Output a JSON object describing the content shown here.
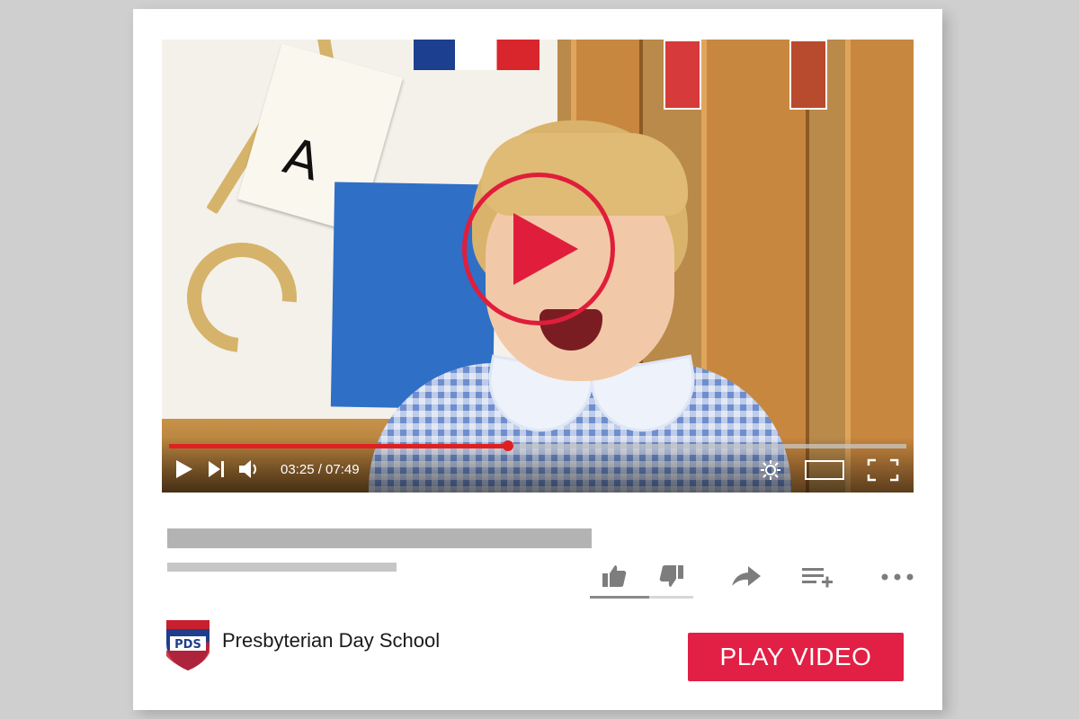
{
  "player": {
    "time_display": "03:25 / 07:49",
    "progress_fraction": 0.46,
    "accent_color": "#e02020",
    "overlay_icon": "play-circle-icon"
  },
  "video_info": {
    "channel_name": "Presbyterian Day School",
    "channel_logo": "PDS",
    "cta_label": "PLAY VIDEO",
    "cta_color": "#e21f44"
  },
  "actions": [
    {
      "name": "like",
      "icon": "thumbs-up-icon"
    },
    {
      "name": "dislike",
      "icon": "thumbs-down-icon"
    },
    {
      "name": "share",
      "icon": "share-arrow-icon"
    },
    {
      "name": "add-to-playlist",
      "icon": "playlist-add-icon"
    },
    {
      "name": "more",
      "icon": "more-dots-icon"
    }
  ],
  "scene_letter": "A"
}
